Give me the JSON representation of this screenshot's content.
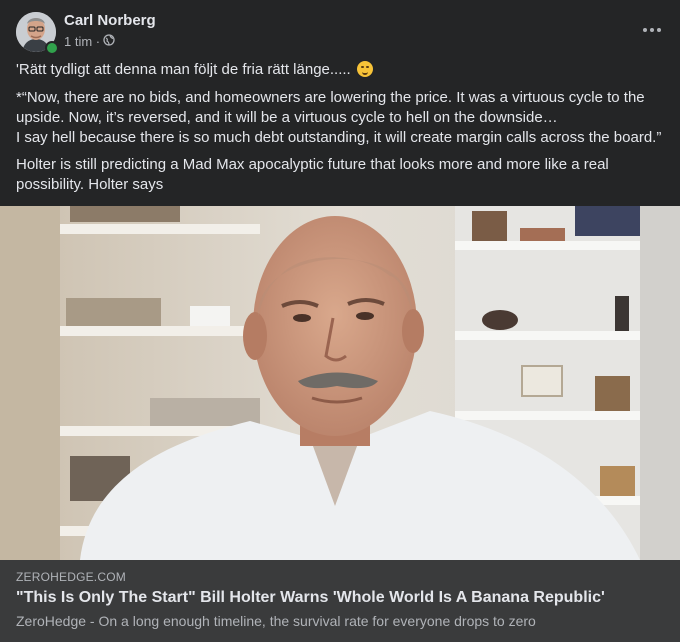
{
  "post": {
    "author": "Carl Norberg",
    "time": "1 tim ·",
    "privacy_icon": "globe-icon",
    "paragraphs": [
      "'Rätt tydligt att denna man följt de fria rätt länge.....",
      "*“Now, there are no bids, and homeowners are lowering the price.  It was a virtuous cycle to the upside.  Now, it’s reversed, and it will be a virtuous cycle to hell on the downside…\nI say hell because there is so much debt outstanding, it will create margin calls across the board.”",
      "Holter is still predicting a Mad Max apocalyptic future that looks more and more like a real possibility.  Holter says"
    ],
    "emoji": "smirk-emoji"
  },
  "link": {
    "domain": "ZEROHEDGE.COM",
    "title": "\"This Is Only The Start\" Bill Holter Warns 'Whole World Is A Banana Republic'",
    "description": "ZeroHedge - On a long enough timeline, the survival rate for everyone drops to zero"
  },
  "colors": {
    "background": "#242526",
    "link_card": "#3a3b3c",
    "primary_text": "#e4e6eb",
    "secondary_text": "#b0b3b8",
    "online": "#31a24c"
  }
}
